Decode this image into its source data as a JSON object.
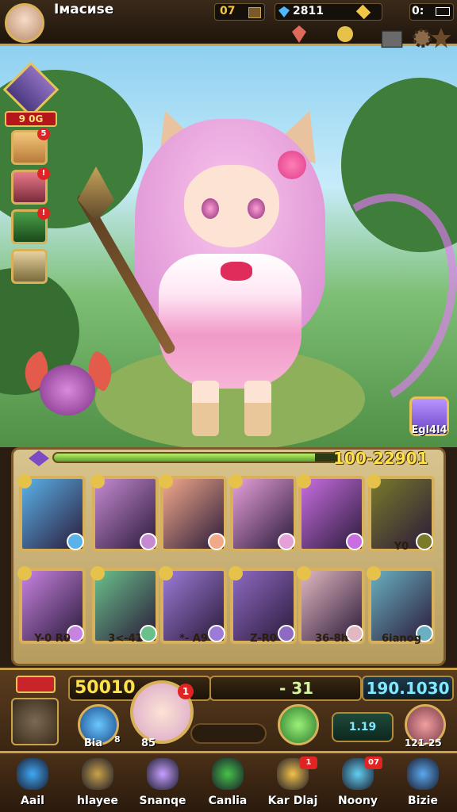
{
  "top_bar": {
    "player_name": "Iмаcиse",
    "gold": "07",
    "gems": "2811",
    "energy": "0:"
  },
  "side_panel": {
    "hero_power": "9 0G"
  },
  "gift": {
    "label": "Egl4l4"
  },
  "xp": {
    "text": "100-22901",
    "fill": 0.92
  },
  "cards_row1": [
    {
      "name": "card-weapon-scythe",
      "bg": "#5ab2e8"
    },
    {
      "name": "card-hero-blonde",
      "bg": "#c58ad1"
    },
    {
      "name": "card-weapon-axe",
      "bg": "#f2a98a"
    },
    {
      "name": "card-weapon-sword",
      "bg": "#e6a0d8"
    },
    {
      "name": "card-hero-violet",
      "bg": "#c86ee0"
    },
    {
      "name": "card-item-crystal",
      "bg": "#7a7a2a",
      "label": "Y0"
    }
  ],
  "cards_row2": [
    {
      "name": "card-hero-purple",
      "bg": "#c783e0",
      "label": "Y-0 R0"
    },
    {
      "name": "card-weapon-blade",
      "bg": "#6ac08a",
      "label": "3<-41"
    },
    {
      "name": "card-hero-brown",
      "bg": "#9c7bd6",
      "label": "*- A9"
    },
    {
      "name": "card-weapon-dagger",
      "bg": "#8e6ac2",
      "label": "Z-R0"
    },
    {
      "name": "card-hero-blonde-2",
      "bg": "#e2b7c0",
      "label": "36-8h"
    },
    {
      "name": "card-hero-shadow",
      "bg": "#6ab0c0",
      "label": "6ianog"
    }
  ],
  "bottom_panel": {
    "score_left": "50010",
    "score_mid": "- 31",
    "score_right": "190.1030",
    "portrait_badge": "1",
    "orb_blue_label": "Bia",
    "orb_blue_sub": "8",
    "portrait_label": "85",
    "box_right_value": "1.19",
    "orb_right_label": "121-25"
  },
  "nav": [
    {
      "name": "nav-search",
      "label": "Aail",
      "icon": "magnifier-icon",
      "color": "#3fa9f5"
    },
    {
      "name": "nav-heroes",
      "label": "hlayee",
      "icon": "statue-icon",
      "color": "#c9a24a"
    },
    {
      "name": "nav-summon",
      "label": "Snanqe",
      "icon": "crystal-icon",
      "color": "#c7a0ff"
    },
    {
      "name": "nav-castle",
      "label": "Canlia",
      "icon": "egg-icon",
      "color": "#46c24a"
    },
    {
      "name": "nav-dial",
      "label": "Kar Dlaj",
      "icon": "gem-icon",
      "color": "#f3c24a",
      "badge": "1"
    },
    {
      "name": "nav-money",
      "label": "Noony",
      "icon": "prism-icon",
      "color": "#63d0f2",
      "badge": "07"
    },
    {
      "name": "nav-store",
      "label": "Bizie",
      "icon": "shop-icon",
      "color": "#5aa9f0"
    }
  ]
}
